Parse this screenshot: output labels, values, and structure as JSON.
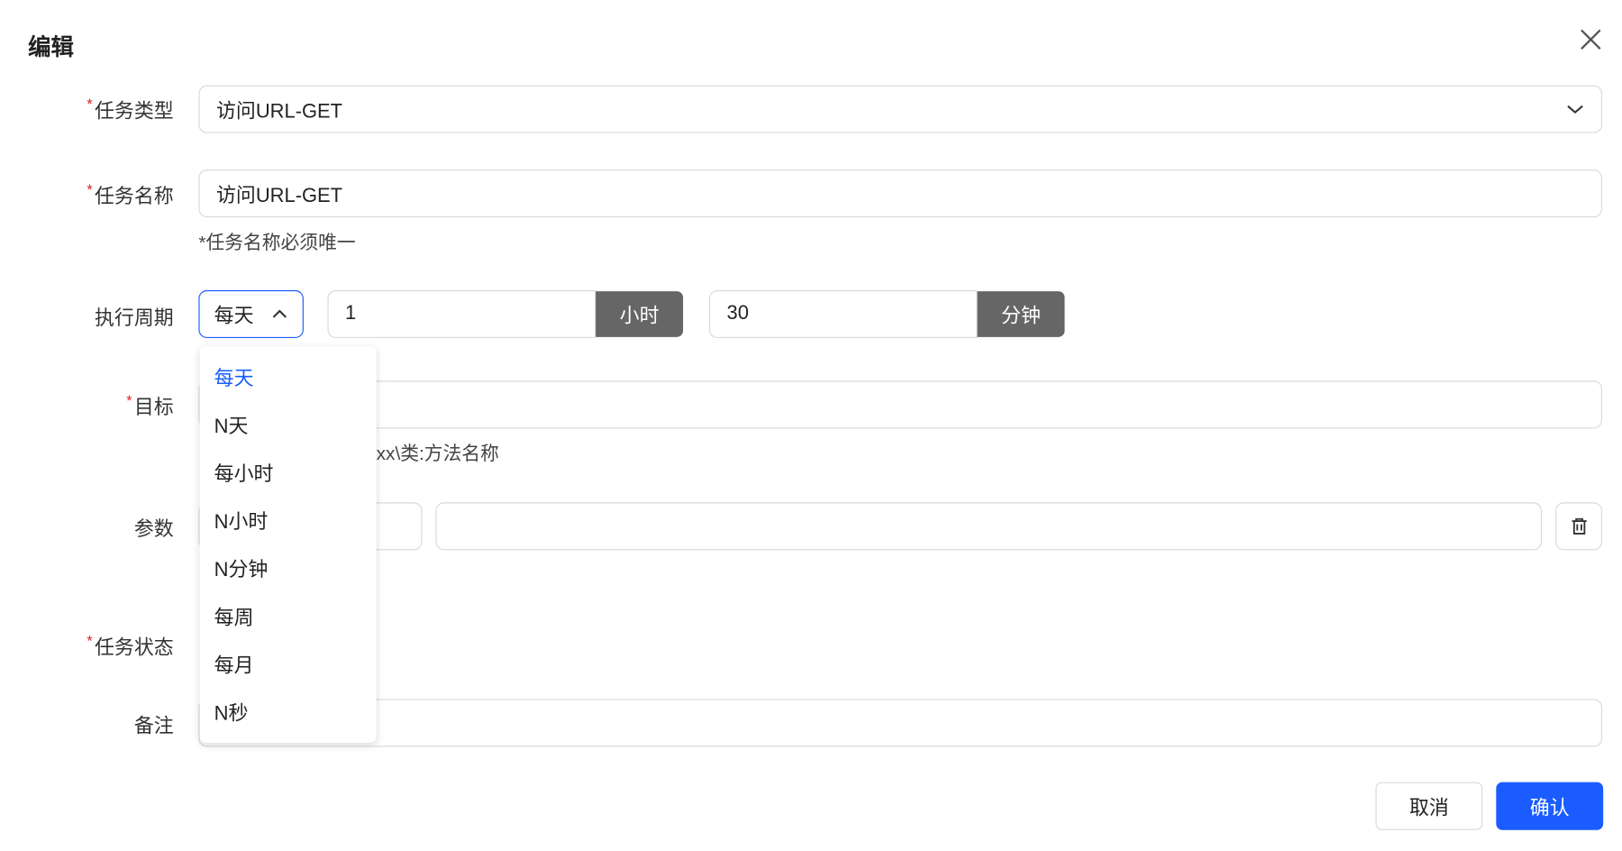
{
  "dialog": {
    "title": "编辑",
    "close_icon": "close-icon"
  },
  "form": {
    "task_type": {
      "label": "任务类型",
      "value": "访问URL-GET"
    },
    "task_name": {
      "label": "任务名称",
      "value": "访问URL-GET",
      "hint": "*任务名称必须唯一"
    },
    "cycle": {
      "label": "执行周期",
      "selected": "每天",
      "hours_value": "1",
      "hours_unit": "小时",
      "minutes_value": "30",
      "minutes_unit": "分钟",
      "options": [
        "每天",
        "N天",
        "每小时",
        "N小时",
        "N分钟",
        "每周",
        "每月",
        "N秒"
      ]
    },
    "target": {
      "label": "目标",
      "value": "",
      "hint": "xx\\类:方法名称"
    },
    "params": {
      "label": "参数",
      "key": "",
      "value": ""
    },
    "status": {
      "label": "任务状态"
    },
    "remark": {
      "label": "备注",
      "value": ""
    }
  },
  "footer": {
    "cancel": "取消",
    "confirm": "确认"
  },
  "colors": {
    "primary": "#1a5cff",
    "unit_button": "#666666",
    "required": "#e02020"
  }
}
